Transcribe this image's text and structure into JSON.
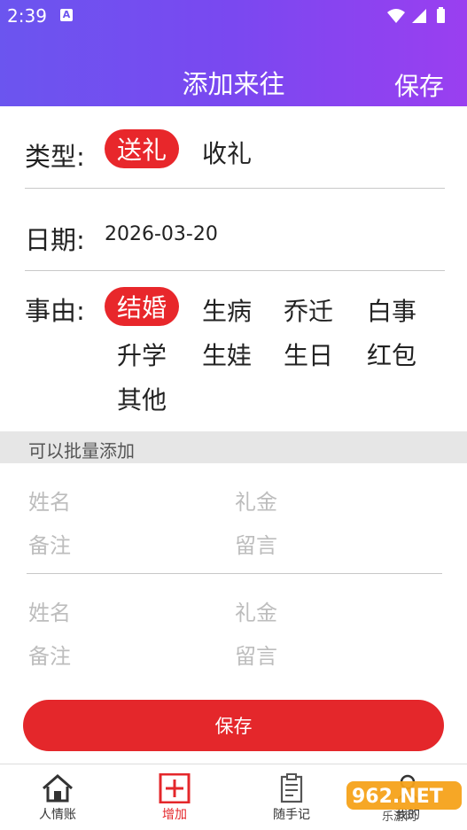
{
  "status_bar": {
    "time": "2:39",
    "notification": "A"
  },
  "header": {
    "title": "添加来往",
    "save": "保存"
  },
  "type_row": {
    "label": "类型:",
    "options": [
      "送礼",
      "收礼"
    ],
    "selected": "送礼"
  },
  "date_row": {
    "label": "日期:",
    "value": "2026-03-20"
  },
  "reason_row": {
    "label": "事由:",
    "options": [
      "结婚",
      "生病",
      "乔迁",
      "白事",
      "升学",
      "生娃",
      "生日",
      "红包",
      "其他"
    ],
    "selected": "结婚"
  },
  "batch": {
    "title": "可以批量添加"
  },
  "entries": [
    {
      "name_placeholder": "姓名",
      "amount_placeholder": "礼金",
      "note_placeholder": "备注",
      "message_placeholder": "留言"
    },
    {
      "name_placeholder": "姓名",
      "amount_placeholder": "礼金",
      "note_placeholder": "备注",
      "message_placeholder": "留言"
    }
  ],
  "save_button": "保存",
  "tabs": [
    {
      "label": "人情账",
      "icon": "home-icon"
    },
    {
      "label": "增加",
      "icon": "add-box-icon",
      "active": true
    },
    {
      "label": "随手记",
      "icon": "notepad-icon"
    },
    {
      "label": "我的",
      "icon": "user-icon"
    }
  ],
  "watermark": "962.NET 乐游网",
  "colors": {
    "accent": "#e4272b",
    "header_start": "#6b55ef",
    "header_end": "#9a3ff0"
  }
}
